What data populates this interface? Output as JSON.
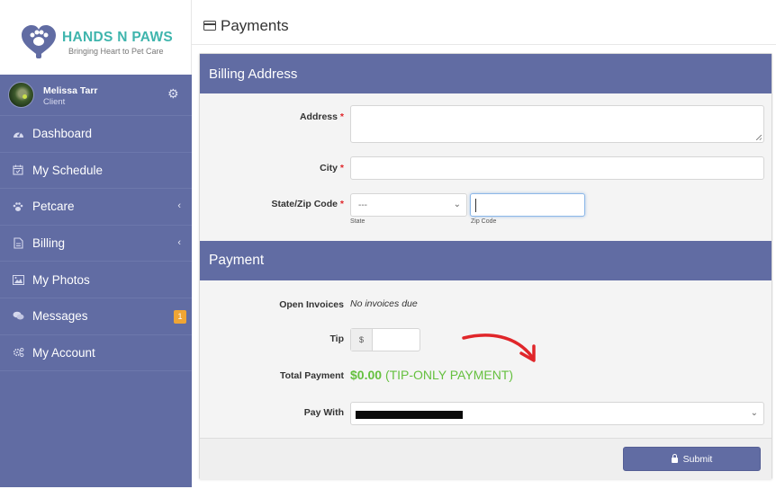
{
  "brand": {
    "name": "HANDS N PAWS",
    "tagline": "Bringing Heart to Pet Care",
    "primary_color": "#616ca3",
    "logo_text_color": "#3fb5ad"
  },
  "user": {
    "name": "Melissa Tarr",
    "role": "Client"
  },
  "sidebar": {
    "items": [
      {
        "label": "Dashboard",
        "icon": "dashboard-icon"
      },
      {
        "label": "My Schedule",
        "icon": "calendar-check-icon"
      },
      {
        "label": "Petcare",
        "icon": "paw-icon",
        "expandable": true
      },
      {
        "label": "Billing",
        "icon": "document-icon",
        "expandable": true
      },
      {
        "label": "My Photos",
        "icon": "image-icon"
      },
      {
        "label": "Messages",
        "icon": "comments-icon",
        "badge": "1",
        "badge_color": "#f0a534"
      },
      {
        "label": "My Account",
        "icon": "cogs-icon"
      }
    ]
  },
  "page": {
    "title": "Payments",
    "icon": "credit-card-icon"
  },
  "billing": {
    "section_title": "Billing Address",
    "address_label": "Address",
    "city_label": "City",
    "state_zip_label": "State/Zip Code",
    "required_marker": "*",
    "address_value": "",
    "city_value": "",
    "state_selected": "---",
    "state_hint": "State",
    "zip_value": "",
    "zip_hint": "Zip Code"
  },
  "payment": {
    "section_title": "Payment",
    "open_invoices_label": "Open Invoices",
    "open_invoices_value": "No invoices due",
    "tip_label": "Tip",
    "tip_prefix": "$",
    "tip_value": "",
    "total_label": "Total Payment",
    "total_amount": "$0.00",
    "total_note": "(TIP-ONLY PAYMENT)",
    "total_color": "#65c03f",
    "pay_with_label": "Pay With",
    "pay_with_value": "[redacted]",
    "submit_label": "Submit"
  },
  "annotation": {
    "arrow_color": "#e0262a"
  }
}
